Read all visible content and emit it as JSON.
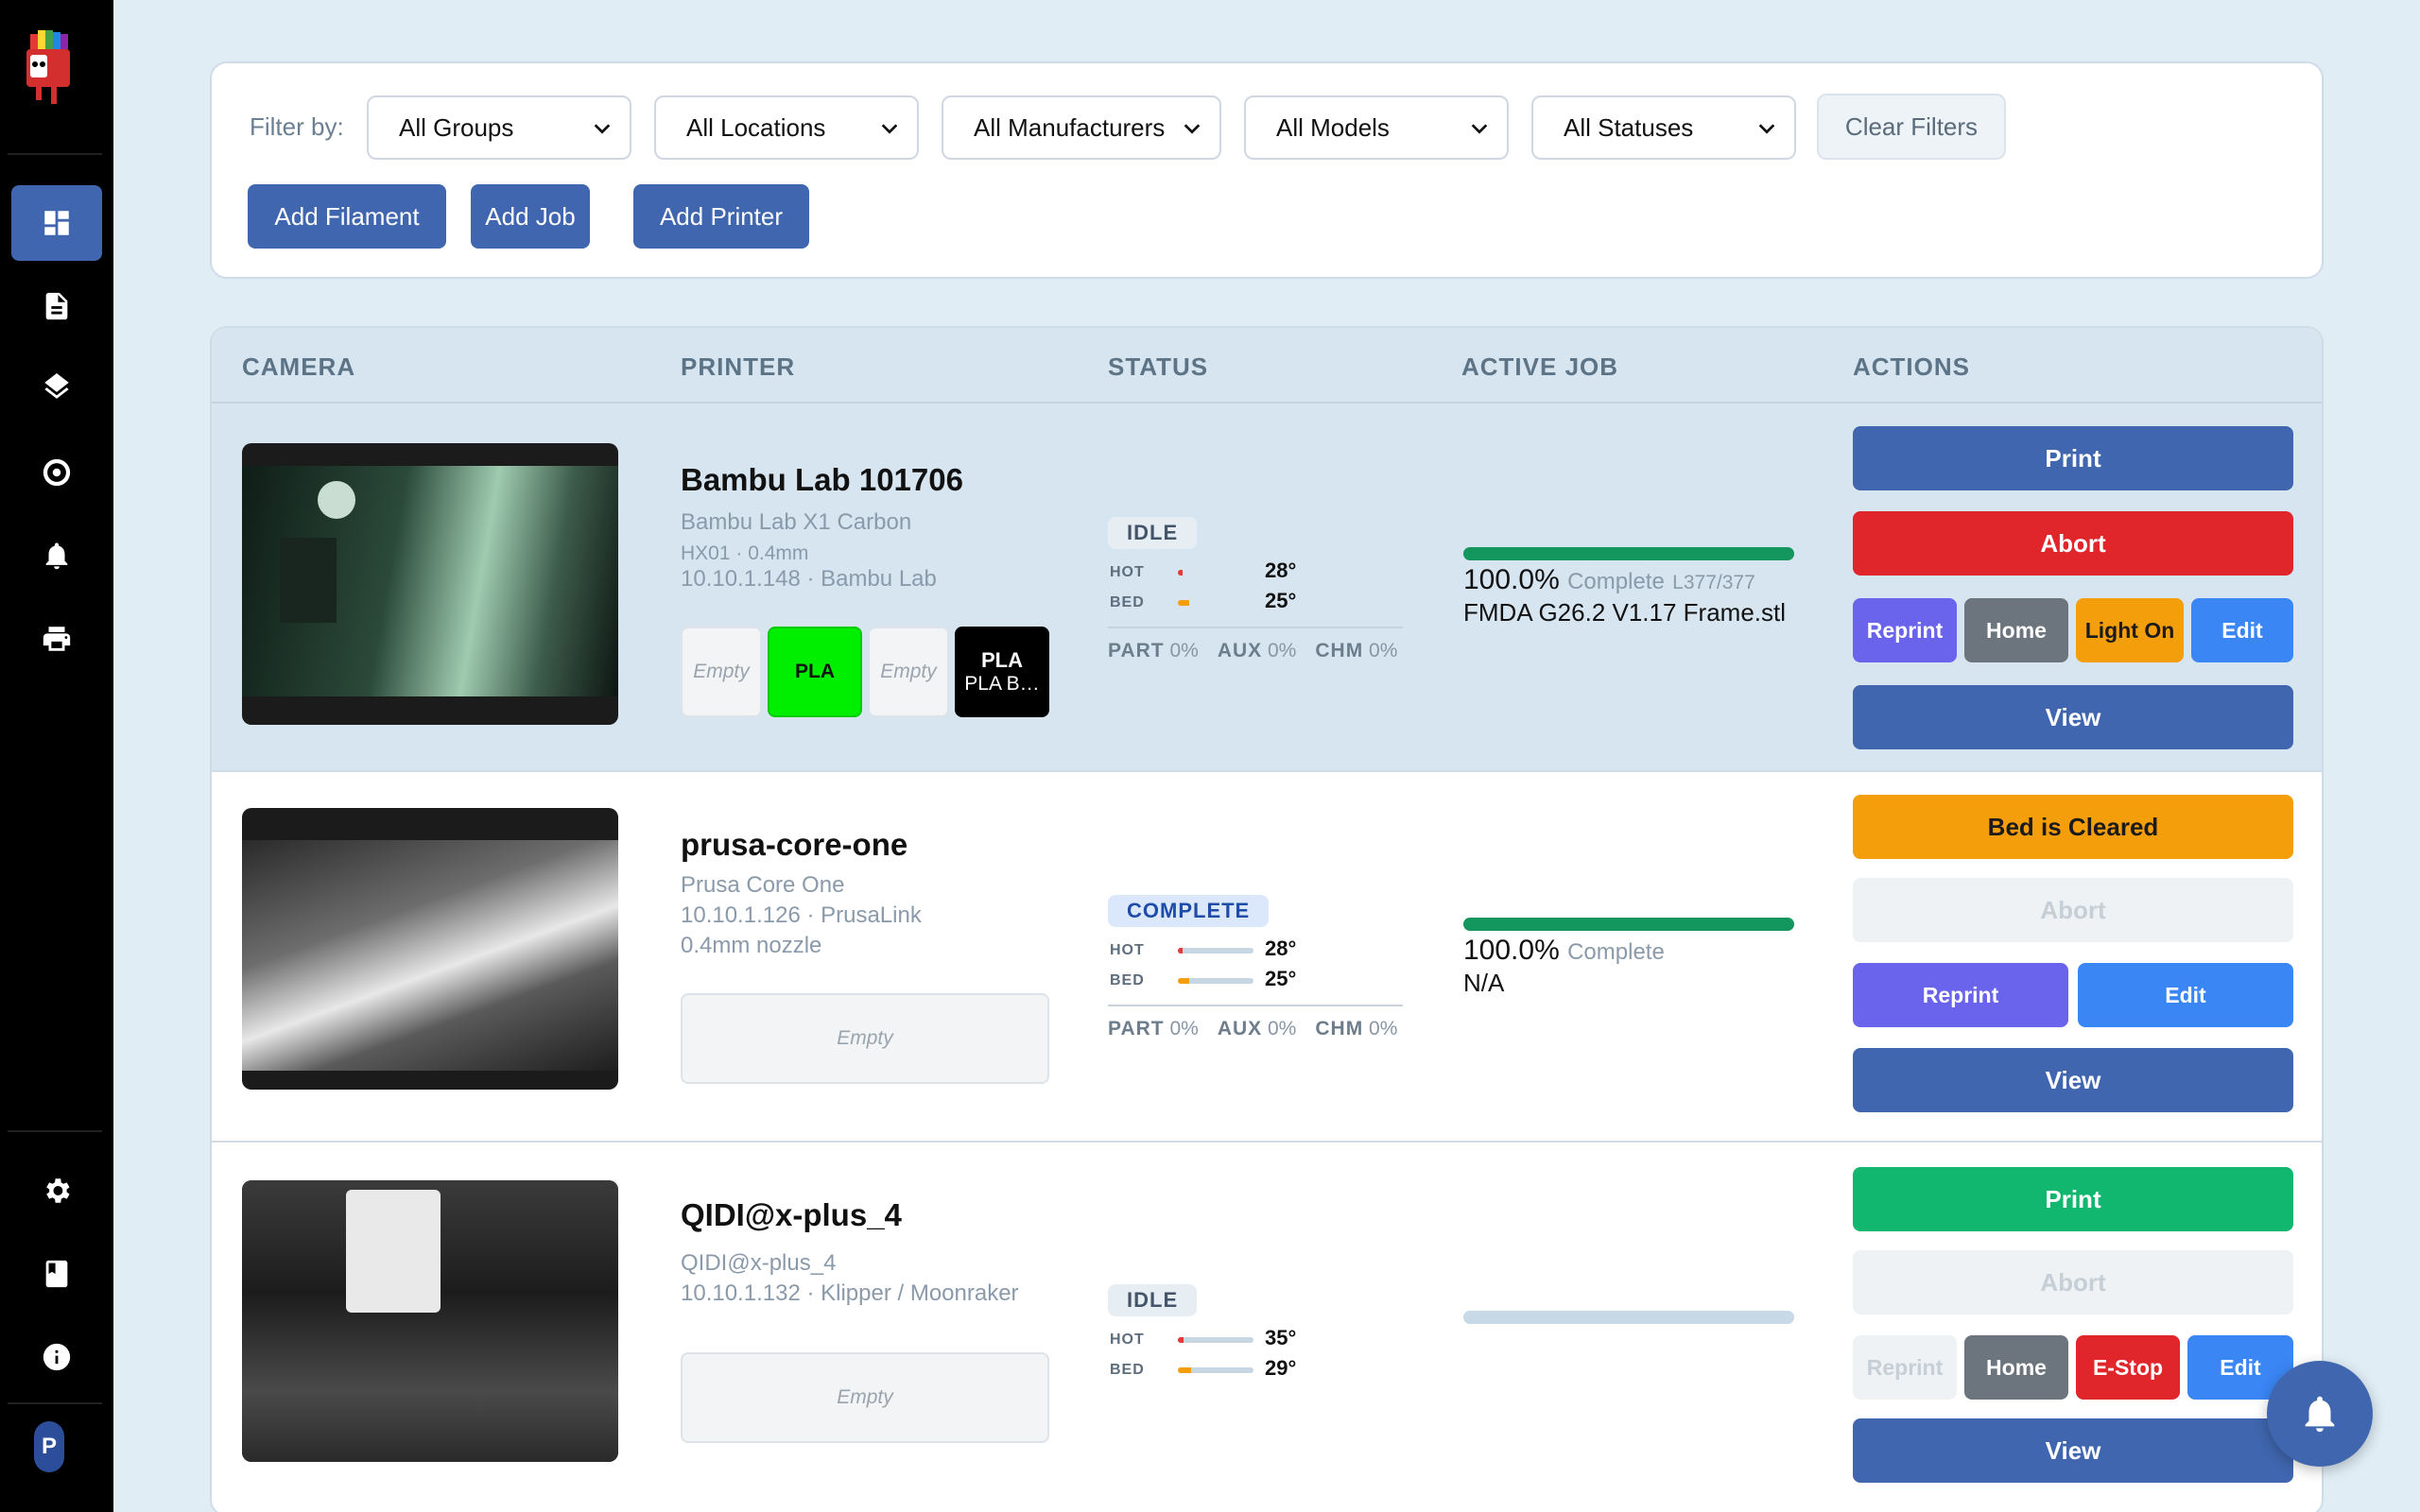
{
  "filters": {
    "label": "Filter by:",
    "groups": "All Groups",
    "locations": "All Locations",
    "manufacturers": "All Manufacturers",
    "models": "All Models",
    "statuses": "All Statuses",
    "clear": "Clear Filters"
  },
  "actions_bar": {
    "add_filament": "Add Filament",
    "add_job": "Add Job",
    "add_printer": "Add Printer"
  },
  "table": {
    "headers": [
      "CAMERA",
      "PRINTER",
      "STATUS",
      "ACTIVE JOB",
      "ACTIONS"
    ]
  },
  "temp_labels": {
    "hot": "HOT",
    "bed": "BED"
  },
  "fan_labels": {
    "part": "PART",
    "aux": "AUX",
    "chm": "CHM"
  },
  "sidebar": {
    "icons": [
      "dashboard-icon",
      "document-icon",
      "layers-icon",
      "target-icon",
      "bell-icon",
      "printer-icon",
      "gear-icon",
      "book-icon",
      "info-icon"
    ],
    "avatar": "P"
  },
  "printers": [
    {
      "name": "Bambu Lab 101706",
      "meta": [
        "Bambu Lab X1 Carbon",
        "HX01 · 0.4mm",
        "10.10.1.148 · Bambu Lab"
      ],
      "slots": [
        {
          "label": "Empty"
        },
        {
          "label": "PLA",
          "color": "#00ee00"
        },
        {
          "label": "Empty"
        },
        {
          "label": "PLA",
          "sub": "PLA B…",
          "color": "#000000"
        }
      ],
      "status": "IDLE",
      "hot": "28°",
      "bed": "25°",
      "hot_level": 0.06,
      "bed_level": 0.15,
      "fans": {
        "part": "0%",
        "aux": "0%",
        "chm": "0%"
      },
      "progress": 100,
      "progress_text": "100.0%",
      "complete": "Complete",
      "layers": "L377/377",
      "file": "FMDA G26.2 V1.17 Frame.stl",
      "buttons": {
        "print": "Print",
        "abort": "Abort",
        "reprint": "Reprint",
        "home": "Home",
        "light": "Light On",
        "edit": "Edit",
        "view": "View"
      }
    },
    {
      "name": "prusa-core-one",
      "meta": [
        "Prusa Core One",
        "10.10.1.126 · PrusaLink",
        "0.4mm nozzle"
      ],
      "slots": [
        {
          "label": "Empty"
        }
      ],
      "status": "COMPLETE",
      "hot": "28°",
      "bed": "25°",
      "hot_level": 0.06,
      "bed_level": 0.15,
      "fans": {
        "part": "0%",
        "aux": "0%",
        "chm": "0%"
      },
      "progress": 100,
      "progress_text": "100.0%",
      "complete": "Complete",
      "file": "N/A",
      "buttons": {
        "cleared": "Bed is Cleared",
        "abort": "Abort",
        "reprint": "Reprint",
        "edit": "Edit",
        "view": "View"
      }
    },
    {
      "name": "QIDI@x-plus_4",
      "meta": [
        "QIDI@x-plus_4",
        "10.10.1.132 · Klipper / Moonraker"
      ],
      "slots": [
        {
          "label": "Empty"
        }
      ],
      "status": "IDLE",
      "hot": "35°",
      "bed": "29°",
      "hot_level": 0.08,
      "bed_level": 0.18,
      "progress": 0,
      "buttons": {
        "print": "Print",
        "abort": "Abort",
        "reprint": "Reprint",
        "home": "Home",
        "estop": "E-Stop",
        "edit": "Edit",
        "view": "View"
      }
    }
  ],
  "colors": {
    "primary": "#3f66ae",
    "danger": "#e0252b",
    "success": "#12b76f",
    "warning": "#f59e0b",
    "progress": "#13975e"
  }
}
